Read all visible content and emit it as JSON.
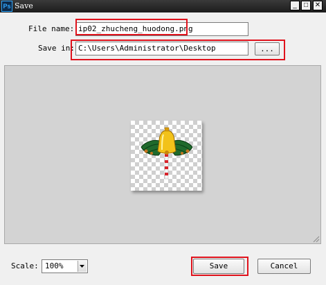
{
  "window": {
    "app_icon": "Ps",
    "title": "Save",
    "minimize_icon": "minimize-icon",
    "maximize_icon": "maximize-icon",
    "close_icon": "close-icon",
    "minimize_glyph": "_",
    "maximize_glyph": "□",
    "close_glyph": "✕"
  },
  "form": {
    "file_name_label": "File name:",
    "file_name_value": "ip02_zhucheng_huodong.png",
    "save_in_label": "Save in:",
    "save_in_value": "C:\\Users\\Administrator\\Desktop",
    "browse_label": "..."
  },
  "preview": {
    "thumbnail_icon": "bell-umbrella-sprite-icon"
  },
  "footer": {
    "scale_label": "Scale:",
    "scale_value": "100%",
    "save_label": "Save",
    "cancel_label": "Cancel"
  },
  "colors": {
    "highlight": "#e0121c",
    "titlebar": "#1c1c1c",
    "preview_bg": "#d3d3d3"
  }
}
